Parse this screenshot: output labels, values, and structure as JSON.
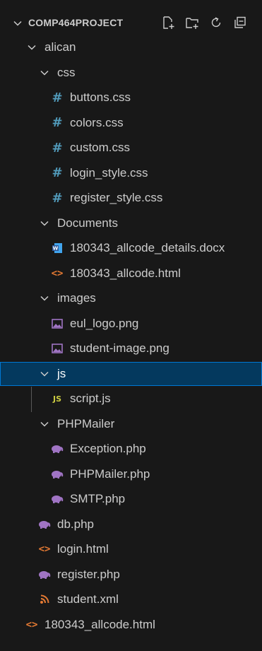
{
  "explorer": {
    "project_title": "COMP464PROJECT",
    "actions": [
      {
        "name": "new-file-icon"
      },
      {
        "name": "new-folder-icon"
      },
      {
        "name": "refresh-icon"
      },
      {
        "name": "collapse-all-icon"
      }
    ],
    "tree": [
      {
        "label": "alican",
        "kind": "folder",
        "depth": 0
      },
      {
        "label": "css",
        "kind": "folder",
        "depth": 1
      },
      {
        "label": "buttons.css",
        "kind": "css",
        "depth": 2
      },
      {
        "label": "colors.css",
        "kind": "css",
        "depth": 2
      },
      {
        "label": "custom.css",
        "kind": "css",
        "depth": 2
      },
      {
        "label": "login_style.css",
        "kind": "css",
        "depth": 2
      },
      {
        "label": "register_style.css",
        "kind": "css",
        "depth": 2
      },
      {
        "label": "Documents",
        "kind": "folder",
        "depth": 1
      },
      {
        "label": "180343_allcode_details.docx",
        "kind": "docx",
        "depth": 2
      },
      {
        "label": "180343_allcode.html",
        "kind": "html",
        "depth": 2
      },
      {
        "label": "images",
        "kind": "folder",
        "depth": 1
      },
      {
        "label": "eul_logo.png",
        "kind": "image",
        "depth": 2
      },
      {
        "label": "student-image.png",
        "kind": "image",
        "depth": 2
      },
      {
        "label": "js",
        "kind": "folder",
        "depth": 1,
        "selected": true
      },
      {
        "label": "script.js",
        "kind": "js",
        "depth": 2
      },
      {
        "label": "PHPMailer",
        "kind": "folder",
        "depth": 1
      },
      {
        "label": "Exception.php",
        "kind": "php",
        "depth": 2
      },
      {
        "label": "PHPMailer.php",
        "kind": "php",
        "depth": 2
      },
      {
        "label": "SMTP.php",
        "kind": "php",
        "depth": 2
      },
      {
        "label": "db.php",
        "kind": "php",
        "depth": 1
      },
      {
        "label": "login.html",
        "kind": "html",
        "depth": 1
      },
      {
        "label": "register.php",
        "kind": "php",
        "depth": 1
      },
      {
        "label": "student.xml",
        "kind": "xml",
        "depth": 1
      },
      {
        "label": "180343_allcode.html",
        "kind": "html",
        "depth": 0
      }
    ],
    "colors": {
      "background": "#181818",
      "text": "#cccccc",
      "selection_bg": "#04395e",
      "selection_border": "#0078d4",
      "css_icon": "#519aba",
      "html_icon": "#e37933",
      "php_icon": "#a074c4",
      "js_icon": "#cbcb41",
      "xml_icon": "#e37933",
      "image_icon": "#a074c4",
      "docx_icon": "#2b579a"
    }
  }
}
